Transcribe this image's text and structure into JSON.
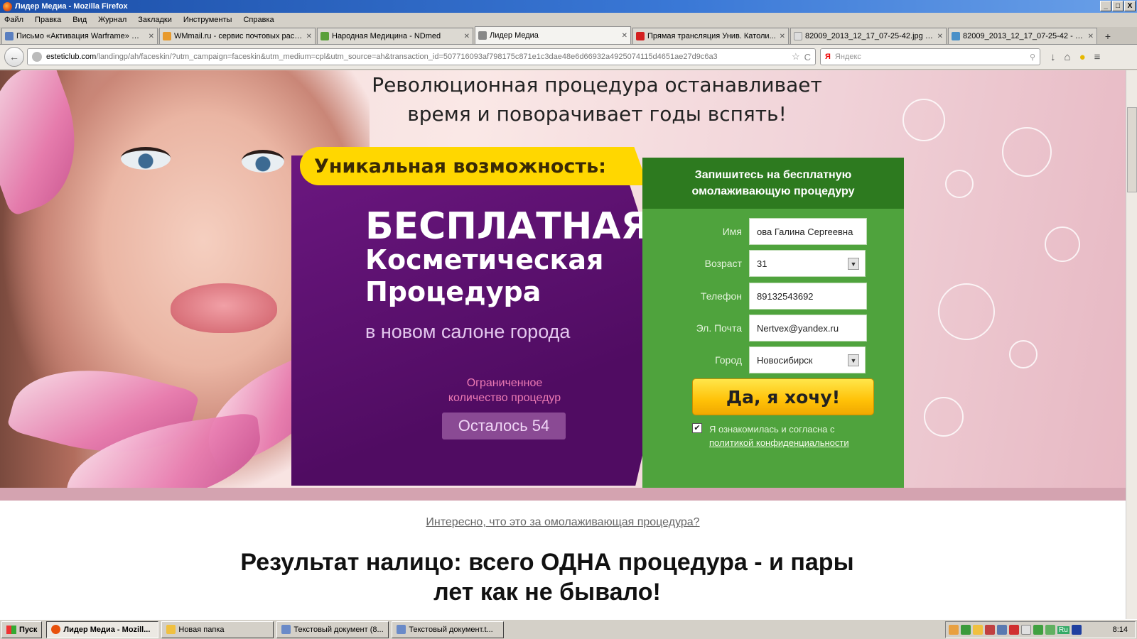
{
  "window": {
    "title": "Лидер Медиа - Mozilla Firefox",
    "controls": [
      "_",
      "□",
      "X"
    ]
  },
  "menu": [
    "Файл",
    "Правка",
    "Вид",
    "Журнал",
    "Закладки",
    "Инструменты",
    "Справка"
  ],
  "tabs": [
    {
      "label": "Письмо «Активация Warframe» —...",
      "color": "#5a7fc0"
    },
    {
      "label": "WMmail.ru - сервис почтовых расс...",
      "color": "#e89a2c"
    },
    {
      "label": "Народная Медицина - NDmed",
      "color": "#5aa03a"
    },
    {
      "label": "Лидер Медиа",
      "color": "#888888",
      "active": true
    },
    {
      "label": "Прямая трансляция Унив. Католи...",
      "color": "#d42020"
    },
    {
      "label": "82009_2013_12_17_07-25-42.jpg (...",
      "color": "#dddddd"
    },
    {
      "label": "82009_2013_12_17_07-25-42 - За...",
      "color": "#4a90c8"
    }
  ],
  "new_tab": "+",
  "nav": {
    "back": "←",
    "url_host": "esteticlub.com",
    "url_path": "/landingp/ah/faceskin/?utm_campaign=faceskin&utm_medium=cpl&utm_source=ah&transaction_id=507716093af798175c871e1c3dae48e6d66932a4925074115d4651ae27d9c6a3",
    "star": "☆",
    "reload": "C",
    "search_engine": "Я",
    "search_placeholder": "Яндекс",
    "search_icon": "⚲",
    "download_icon": "↓",
    "home_icon": "⌂",
    "addon_icon": "●",
    "menu_icon": "≡"
  },
  "page": {
    "headline_line1": "Революционная процедура останавливает",
    "headline_line2": "время и поворачивает годы вспять!",
    "unique": "Уникальная возможность:",
    "offer_big": "БЕСПЛАТНАЯ",
    "offer_mid1": "Косметическая",
    "offer_mid2": "Процедура",
    "offer_sub": "в новом салоне города",
    "limited_line1": "Ограниченное",
    "limited_line2": "количество процедур",
    "remaining": "Осталось 54",
    "form": {
      "title_line1": "Запишитесь на бесплатную",
      "title_line2": "омолаживающую процедуру",
      "name_label": "Имя",
      "name_value": "ова Галина Сергеевна",
      "age_label": "Возраст",
      "age_value": "31",
      "phone_label": "Телефон",
      "phone_value": "89132543692",
      "email_label": "Эл. Почта",
      "email_value": "Nertvex@yandex.ru",
      "city_label": "Город",
      "city_value": "Новосибирск",
      "submit": "Да, я хочу!",
      "consent_checked": "✔",
      "consent_text": "Я ознакомилась и согласна с",
      "consent_link": "политикой конфиденциальности",
      "select_arrow": "▼"
    },
    "question": "Интересно, что это за омолаживающая процедура?",
    "result_line1": "Результат налицо: всего ОДНА процедура - и пары",
    "result_line2": "лет как не бывало!"
  },
  "taskbar": {
    "start": "Пуск",
    "tasks": [
      {
        "label": "Лидер Медиа - Mozill...",
        "color": "#e8510c",
        "active": true
      },
      {
        "label": "Новая папка",
        "color": "#f0c040"
      },
      {
        "label": "Текстовый документ (8...",
        "color": "#6a8ac8"
      },
      {
        "label": "Текстовый документ.t...",
        "color": "#6a8ac8"
      }
    ],
    "lang": "Ru",
    "clock": "8:14"
  }
}
